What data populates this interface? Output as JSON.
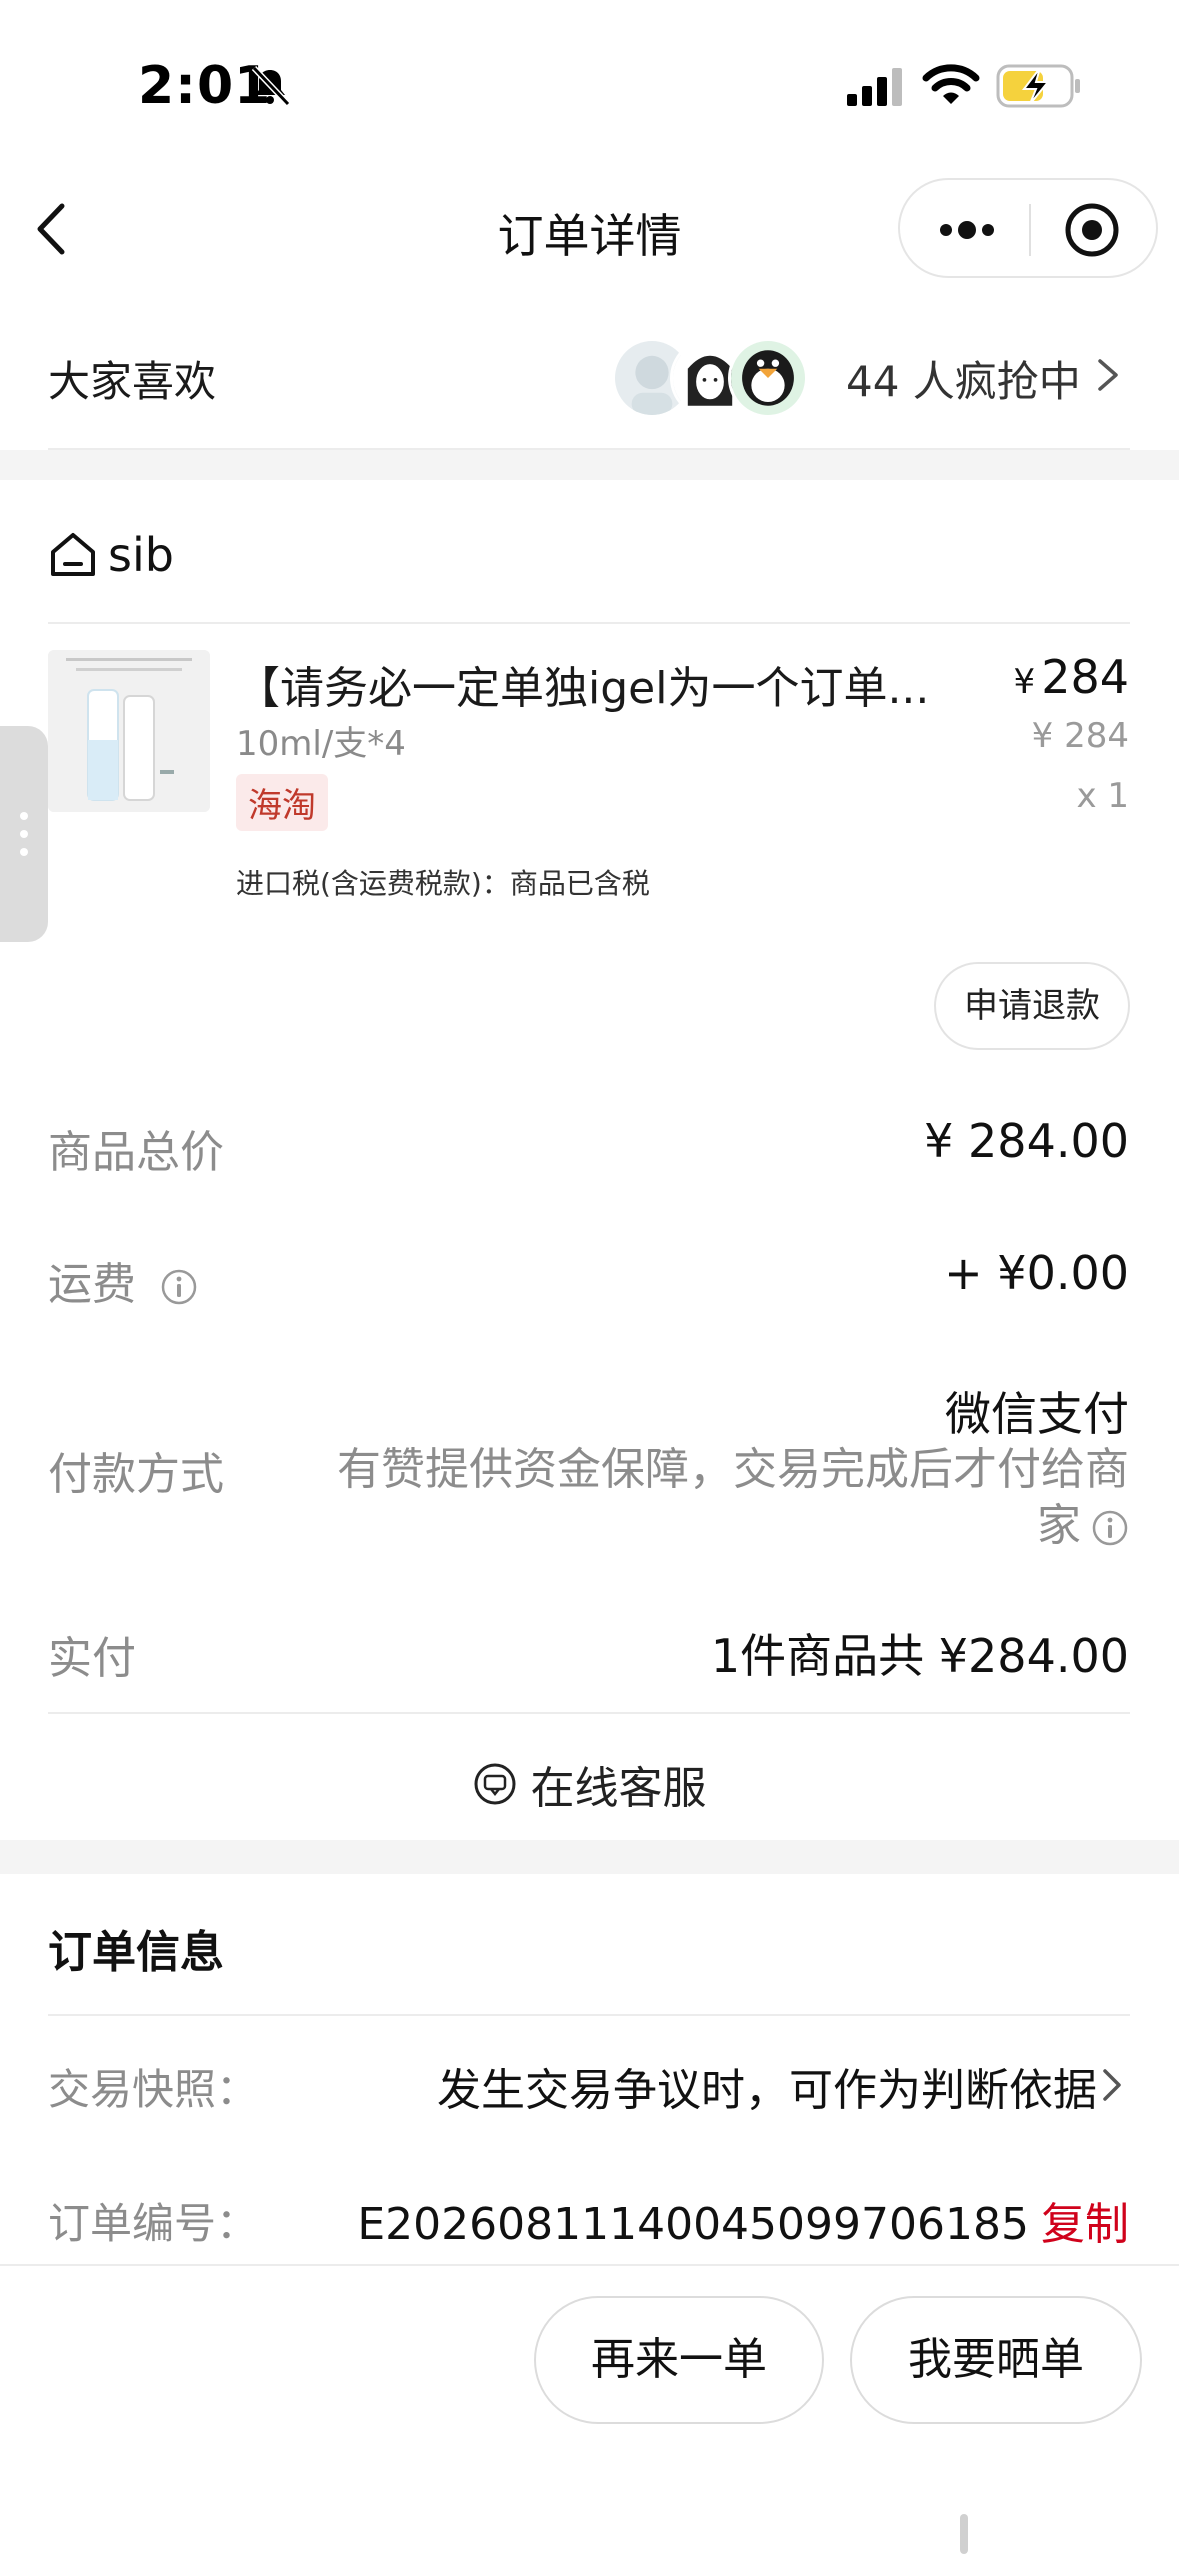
{
  "status_bar": {
    "time": "2:01",
    "icons": [
      "bell-off-icon",
      "signal-icon",
      "wifi-icon",
      "battery-charging-icon"
    ],
    "battery_color": "#f5d23d"
  },
  "nav": {
    "title": "订单详情",
    "icons": [
      "back-icon",
      "more-icon",
      "target-icon"
    ]
  },
  "popular": {
    "label": "大家喜欢",
    "count_text": "44 人疯抢中"
  },
  "shop": {
    "name": "sib",
    "icon": "store-icon"
  },
  "product": {
    "title": "【请务必一定单独igel为一个订单...",
    "price_symbol": "¥",
    "price": "284",
    "spec": "10ml/支*4",
    "original_price": "¥ 284",
    "tag": "海淘",
    "quantity": "x 1",
    "tax_note": "进口税(含运费税款)：商品已含税"
  },
  "actions": {
    "refund": "申请退款",
    "reorder": "再来一单",
    "review": "我要晒单"
  },
  "summary": {
    "goods_total_label": "商品总价",
    "goods_total_value": "¥ 284.00",
    "shipping_label": "运费",
    "shipping_value": "+ ¥0.00",
    "payment_label": "付款方式",
    "payment_method": "微信支付",
    "payment_note": "有赞提供资金保障，交易完成后才付给商家",
    "paid_label": "实付",
    "paid_value": "1件商品共 ¥284.00",
    "service_label": "在线客服"
  },
  "order_info": {
    "title": "订单信息",
    "snapshot_label": "交易快照：",
    "snapshot_value": "发生交易争议时，可作为判断依据",
    "number_label": "订单编号：",
    "number_value": "E20260811140045099706185",
    "copy_label": "复制"
  },
  "colors": {
    "accent_red": "#d0021b",
    "tag_red": "#c0392b",
    "muted_text": "#8c8c8c",
    "divider": "#ececec",
    "band": "#f4f4f4"
  }
}
